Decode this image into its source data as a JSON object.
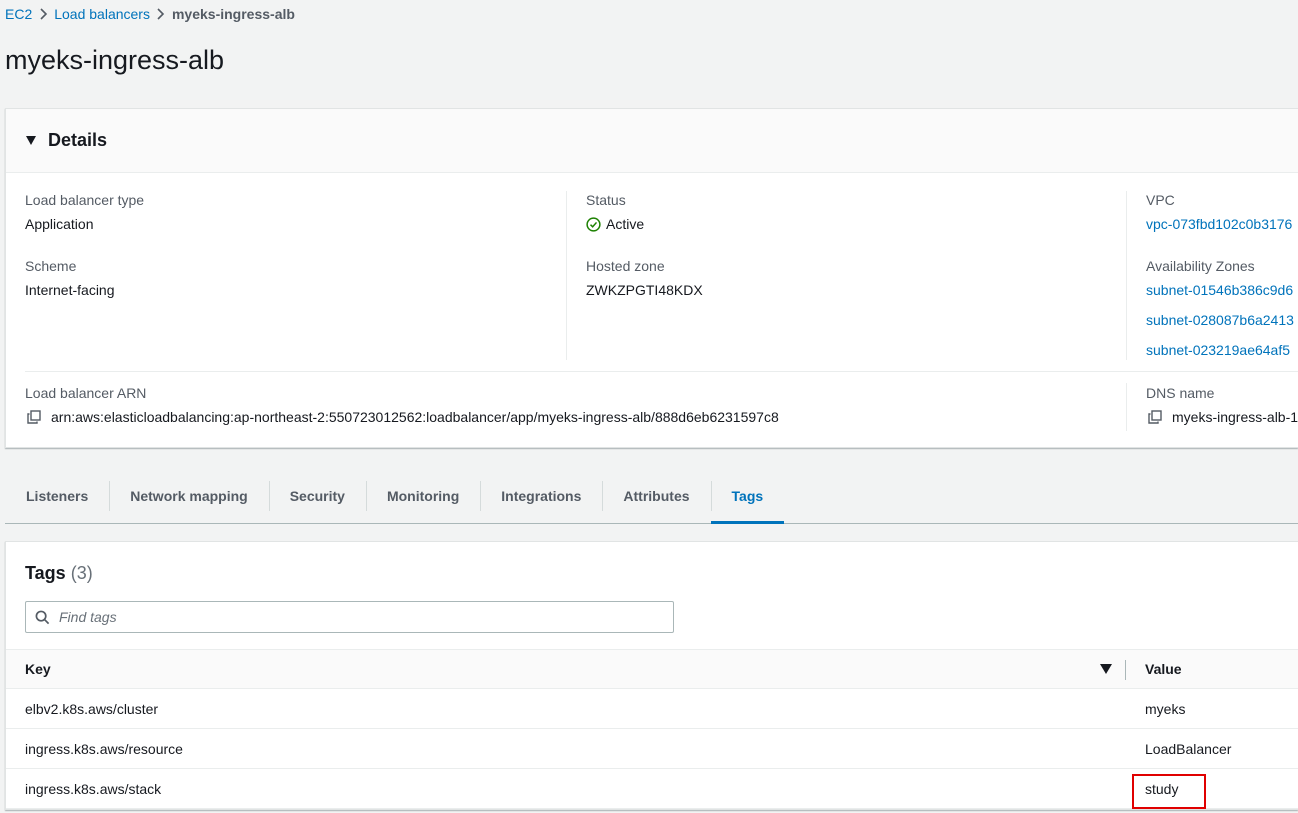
{
  "breadcrumb": {
    "items": [
      "EC2",
      "Load balancers"
    ],
    "current": "myeks-ingress-alb"
  },
  "page_title": "myeks-ingress-alb",
  "details": {
    "title": "Details",
    "lb_type": {
      "label": "Load balancer type",
      "value": "Application"
    },
    "scheme": {
      "label": "Scheme",
      "value": "Internet-facing"
    },
    "status": {
      "label": "Status",
      "value": "Active",
      "color": "#1d8102"
    },
    "hosted_zone": {
      "label": "Hosted zone",
      "value": "ZWKZPGTI48KDX"
    },
    "vpc": {
      "label": "VPC",
      "value": "vpc-073fbd102c0b3176"
    },
    "azs": {
      "label": "Availability Zones",
      "subnets": [
        "subnet-01546b386c9d6",
        "subnet-028087b6a2413",
        "subnet-023219ae64af5"
      ]
    },
    "arn": {
      "label": "Load balancer ARN",
      "value": "arn:aws:elasticloadbalancing:ap-northeast-2:550723012562:loadbalancer/app/myeks-ingress-alb/888d6eb6231597c8"
    },
    "dns": {
      "label": "DNS name",
      "value": "myeks-ingress-alb-1"
    }
  },
  "tabs": [
    {
      "label": "Listeners"
    },
    {
      "label": "Network mapping"
    },
    {
      "label": "Security"
    },
    {
      "label": "Monitoring"
    },
    {
      "label": "Integrations"
    },
    {
      "label": "Attributes"
    },
    {
      "label": "Tags",
      "active": true
    }
  ],
  "tags": {
    "title": "Tags",
    "count": "(3)",
    "search_placeholder": "Find tags",
    "columns": {
      "key": "Key",
      "value": "Value"
    },
    "rows": [
      {
        "key": "elbv2.k8s.aws/cluster",
        "value": "myeks"
      },
      {
        "key": "ingress.k8s.aws/resource",
        "value": "LoadBalancer"
      },
      {
        "key": "ingress.k8s.aws/stack",
        "value": "study"
      }
    ]
  },
  "colors": {
    "link": "#0073bb",
    "accent": "#0073bb",
    "highlight": "#e00000"
  }
}
